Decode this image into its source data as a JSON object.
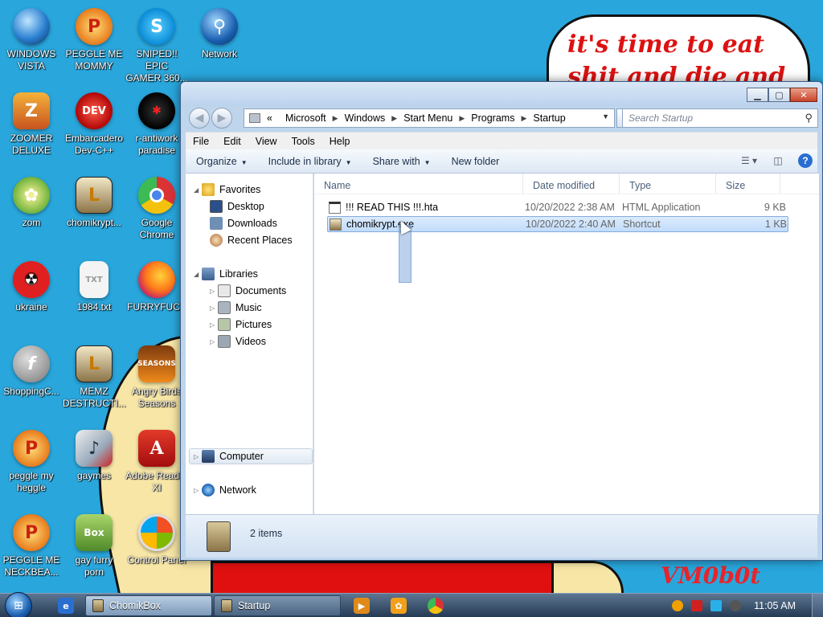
{
  "wallpaper": {
    "bubble_text": "it's time to eat shit and die and chew",
    "signature": "VM0b0t"
  },
  "desktop_icons": [
    {
      "label": "WINDOWS\nVISTA",
      "icon": "vista-orb-icon"
    },
    {
      "label": "PEGGLE ME\nMOMMY",
      "icon": "peggle-icon"
    },
    {
      "label": "SNIPED!! EPIC\nGAMER 360...",
      "icon": "skype-icon"
    },
    {
      "label": "Network",
      "icon": "network-globe-icon"
    },
    {
      "label": "ZOOMER\nDELUXE",
      "icon": "zoomer-icon"
    },
    {
      "label": "Embarcadero\nDev-C++",
      "icon": "devcpp-icon"
    },
    {
      "label": "r-antiwork\nparadise",
      "icon": "antiwork-icon"
    },
    {
      "label": "zom",
      "icon": "plant-icon"
    },
    {
      "label": "chomikrypt...",
      "icon": "shortcut-clock-icon"
    },
    {
      "label": "Google\nChrome",
      "icon": "chrome-icon"
    },
    {
      "label": "ukraine",
      "icon": "radiation-icon"
    },
    {
      "label": "1984.txt",
      "icon": "text-file-icon"
    },
    {
      "label": "FURRYFUCK",
      "icon": "firefox-icon"
    },
    {
      "label": "ShoppingC...",
      "icon": "flash-icon"
    },
    {
      "label": "MEMZ\nDESTRUCTI...",
      "icon": "shortcut-clock-icon"
    },
    {
      "label": "Angry Birds\nSeasons",
      "icon": "angry-birds-icon"
    },
    {
      "label": "peggle my\nheggle",
      "icon": "peggle-icon"
    },
    {
      "label": "gaymes",
      "icon": "games-folder-icon"
    },
    {
      "label": "Adobe Reader\nXI",
      "icon": "adobe-reader-icon"
    },
    {
      "label": "PEGGLE ME\nNECKBEA...",
      "icon": "peggle-icon"
    },
    {
      "label": "gay furry\nporn",
      "icon": "box-beaver-icon"
    },
    {
      "label": "Control Panel",
      "icon": "control-panel-icon"
    }
  ],
  "window": {
    "address": {
      "overflow": "«",
      "crumbs": [
        "Microsoft",
        "Windows",
        "Start Menu",
        "Programs",
        "Startup"
      ]
    },
    "search_placeholder": "Search Startup",
    "menu": [
      "File",
      "Edit",
      "View",
      "Tools",
      "Help"
    ],
    "commands": {
      "organize": "Organize",
      "include": "Include in library",
      "share": "Share with",
      "new_folder": "New folder"
    },
    "nav": {
      "favorites": "Favorites",
      "desktop": "Desktop",
      "downloads": "Downloads",
      "recent": "Recent Places",
      "libraries": "Libraries",
      "documents": "Documents",
      "music": "Music",
      "pictures": "Pictures",
      "videos": "Videos",
      "computer": "Computer",
      "network": "Network"
    },
    "columns": {
      "name": "Name",
      "date": "Date modified",
      "type": "Type",
      "size": "Size"
    },
    "files": [
      {
        "name": "!!! READ THIS !!!.hta",
        "date": "10/20/2022 2:38 AM",
        "type": "HTML Application",
        "size": "9 KB"
      },
      {
        "name": "chomikrypt.exe",
        "date": "10/20/2022 2:40 AM",
        "type": "Shortcut",
        "size": "1 KB"
      }
    ],
    "item_count": "2 items"
  },
  "taskbar": {
    "buttons": [
      {
        "label": "ChomikBox"
      },
      {
        "label": "Startup"
      }
    ],
    "clock": "11:05 AM"
  }
}
